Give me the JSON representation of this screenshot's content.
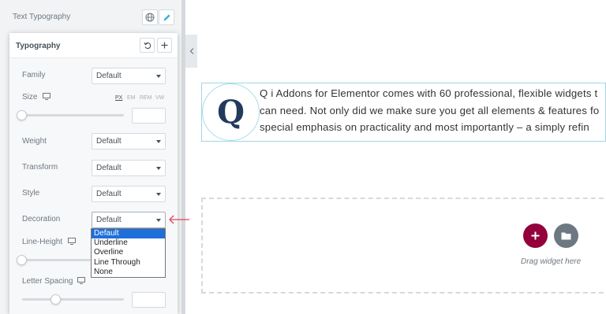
{
  "editor": {
    "section_label": "Text Typography",
    "popover": {
      "title": "Typography",
      "family": {
        "label": "Family",
        "value": "Default"
      },
      "size": {
        "label": "Size",
        "units": [
          "PX",
          "EM",
          "REM",
          "VW"
        ],
        "active_unit": "PX"
      },
      "weight": {
        "label": "Weight",
        "value": "Default"
      },
      "transform": {
        "label": "Transform",
        "value": "Default"
      },
      "style": {
        "label": "Style",
        "value": "Default"
      },
      "decoration": {
        "label": "Decoration",
        "value": "Default",
        "options": [
          "Default",
          "Underline",
          "Overline",
          "Line Through",
          "None"
        ]
      },
      "line_height": {
        "label": "Line-Height"
      },
      "letter_spacing": {
        "label": "Letter Spacing"
      }
    }
  },
  "canvas": {
    "logo_letter": "Q",
    "paragraph": [
      "Q i Addons for Elementor comes with 60 professional, flexible widgets t",
      "can need. Not only did we make sure you get all elements & features fo",
      "special emphasis on practicality and most importantly – a simply refin"
    ],
    "drag_hint": "Drag widget here"
  },
  "colors": {
    "accent": "#93003c",
    "folder": "#6d7882",
    "annotation_arrow": "#e2445c"
  }
}
